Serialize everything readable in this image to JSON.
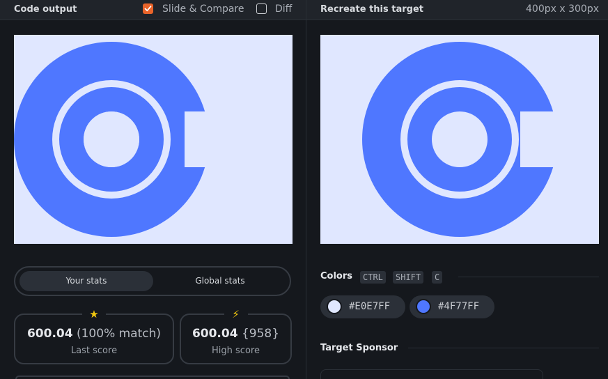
{
  "left": {
    "title": "Code output",
    "slide_compare_label": "Slide & Compare",
    "slide_compare_checked": true,
    "diff_label": "Diff",
    "diff_checked": false
  },
  "right": {
    "title": "Recreate this target",
    "dimensions": "400px x 300px"
  },
  "stats": {
    "tabs": [
      "Your stats",
      "Global stats"
    ],
    "active_tab": "Your stats",
    "last_score_value": "600.04",
    "last_score_match": "(100% match)",
    "last_score_caption": "Last score",
    "high_score_value": "600.04",
    "high_score_extra": "{958}",
    "high_score_caption": "High score",
    "last_icon": "star-icon",
    "high_icon": "lightning-icon"
  },
  "colors_section": {
    "title": "Colors",
    "shortcut": [
      "CTRL",
      "SHIFT",
      "C"
    ],
    "swatches": [
      {
        "hex": "#E0E7FF",
        "color": "#E0E7FF"
      },
      {
        "hex": "#4F77FF",
        "color": "#4F77FF"
      }
    ]
  },
  "sponsor_section": {
    "title": "Target Sponsor"
  },
  "target": {
    "background": "#e0e7ff",
    "foreground": "#4f77ff"
  }
}
